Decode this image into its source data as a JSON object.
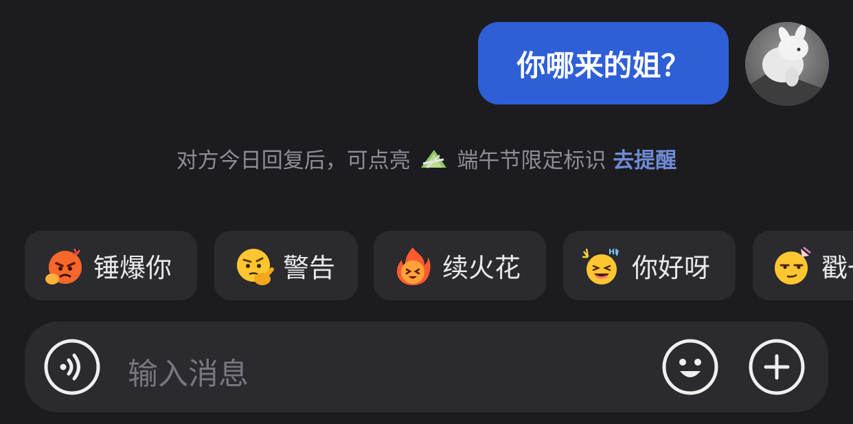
{
  "message": {
    "text": "你哪来的姐？",
    "bubble_color": "#2f5fd6"
  },
  "notice": {
    "prefix": "对方今日回复后，可点亮",
    "badge_icon": "zongzi-badge-icon",
    "suffix": "端午节限定标识",
    "action": "去提醒"
  },
  "quick_replies": [
    {
      "label": "锤爆你",
      "icon": "angry-hammer-emoji-icon"
    },
    {
      "label": "警告",
      "icon": "warning-face-emoji-icon"
    },
    {
      "label": "续火花",
      "icon": "fire-emoji-icon"
    },
    {
      "label": "你好呀",
      "icon": "hello-laugh-emoji-icon"
    },
    {
      "label": "戳一",
      "icon": "smirk-emoji-icon"
    }
  ],
  "input": {
    "placeholder": "输入消息",
    "voice_icon": "voice-icon",
    "emoji_icon": "emoji-icon",
    "plus_icon": "plus-icon"
  },
  "colors": {
    "background": "#1c1c20",
    "chip": "#2a2a2f",
    "link": "#6f8cd6"
  }
}
